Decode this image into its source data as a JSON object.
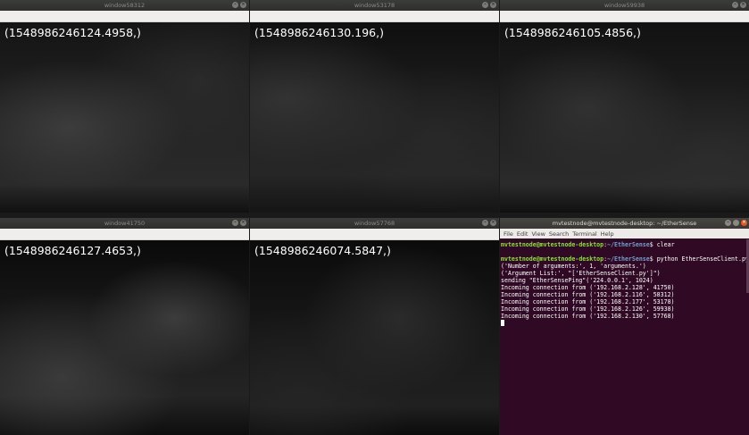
{
  "windows": [
    {
      "title": "window58312",
      "timestamp": "(1548986246124.4958,)"
    },
    {
      "title": "window53178",
      "timestamp": "(1548986246130.196,)"
    },
    {
      "title": "window59938",
      "timestamp": "(1548986246105.4856,)"
    },
    {
      "title": "window41750",
      "timestamp": "(1548986246127.4653,)"
    },
    {
      "title": "window57768",
      "timestamp": "(1548986246074.5847,)"
    }
  ],
  "window_buttons": {
    "minimize": "–",
    "close": "×"
  },
  "terminal": {
    "title": "mvtestnode@mvtestnode-desktop: ~/EtherSense",
    "menu": [
      "File",
      "Edit",
      "View",
      "Search",
      "Terminal",
      "Help"
    ],
    "prompt_user": "mvtestnode@mvtestnode-desktop",
    "prompt_sep": ":",
    "prompt_path": "~/EtherSense",
    "cmd1": "$ clear",
    "cmd2": "$ python EtherSenseClient.py",
    "out": [
      "('Number of arguments:', 1, 'arguments.')",
      "('Argument List:', \"['EtherSenseClient.py']\")",
      "sending \"EtherSensePing\"('224.0.0.1', 1024)",
      "Incoming connection from ('192.168.2.128', 41750)",
      "Incoming connection from ('192.168.2.116', 58312)",
      "Incoming connection from ('192.168.2.177', 53178)",
      "Incoming connection from ('192.168.2.126', 59938)",
      "Incoming connection from ('192.168.2.130', 57768)"
    ]
  }
}
